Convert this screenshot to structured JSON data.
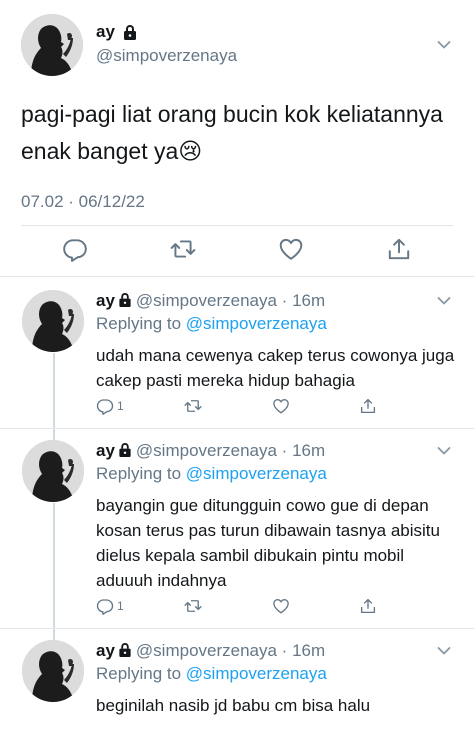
{
  "main_tweet": {
    "name": "ay",
    "handle": "@simpoverzenaya",
    "text": "pagi-pagi liat orang bucin kok keliatannya enak banget ya😢",
    "timestamp": "07.02 · 06/12/22",
    "actions": [
      "reply-icon",
      "retweet-icon",
      "like-icon",
      "share-icon"
    ]
  },
  "replies": [
    {
      "name": "ay",
      "handle_time": "@simpoverzenaya · 16m",
      "replying_prefix": "Replying to",
      "replying_to": "@simpoverzenaya",
      "text": "udah mana cewenya cakep terus cowonya juga cakep pasti mereka hidup bahagia",
      "reply_count": "1"
    },
    {
      "name": "ay",
      "handle_time": "@simpoverzenaya · 16m",
      "replying_prefix": "Replying to",
      "replying_to": "@simpoverzenaya",
      "text": "bayangin gue ditungguin cowo gue di depan kosan terus pas turun dibawain tasnya abisitu dielus kepala sambil dibukain pintu mobil aduuuh indahnya",
      "reply_count": "1"
    },
    {
      "name": "ay",
      "handle_time": "@simpoverzenaya · 16m",
      "replying_prefix": "Replying to",
      "replying_to": "@simpoverzenaya",
      "text": "beginilah nasib jd babu cm bisa halu"
    }
  ],
  "colors": {
    "text": "#14171a",
    "muted": "#657786",
    "link": "#1da1f2",
    "divider": "#e1e8ed"
  }
}
